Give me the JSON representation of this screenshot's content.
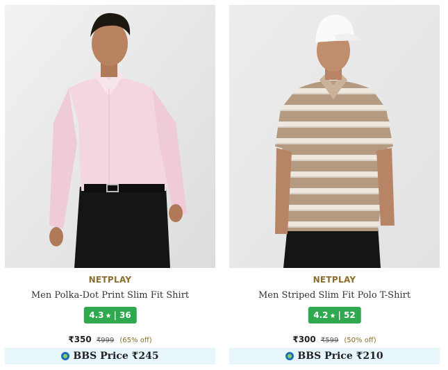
{
  "products": [
    {
      "brand": "NETPLAY",
      "name": "Men Polka-Dot Print Slim Fit Shirt",
      "rating": "4.3",
      "review_count": "36",
      "price": "₹350",
      "mrp": "₹999",
      "discount": "(65% off)",
      "bbs_label": "BBS Price ₹245",
      "image_icon": "model-in-pink-shirt-image"
    },
    {
      "brand": "NETPLAY",
      "name": "Men Striped Slim Fit Polo T-Shirt",
      "rating": "4.2",
      "review_count": "52",
      "price": "₹300",
      "mrp": "₹599",
      "discount": "(50% off)",
      "bbs_label": "BBS Price ₹210",
      "image_icon": "model-in-striped-polo-image"
    }
  ],
  "rating_separator": "|",
  "star_glyph": "★",
  "colors": {
    "brand": "#8a6d2d",
    "rating_badge": "#2fa84f",
    "bbs_background": "#e7f6fb"
  }
}
